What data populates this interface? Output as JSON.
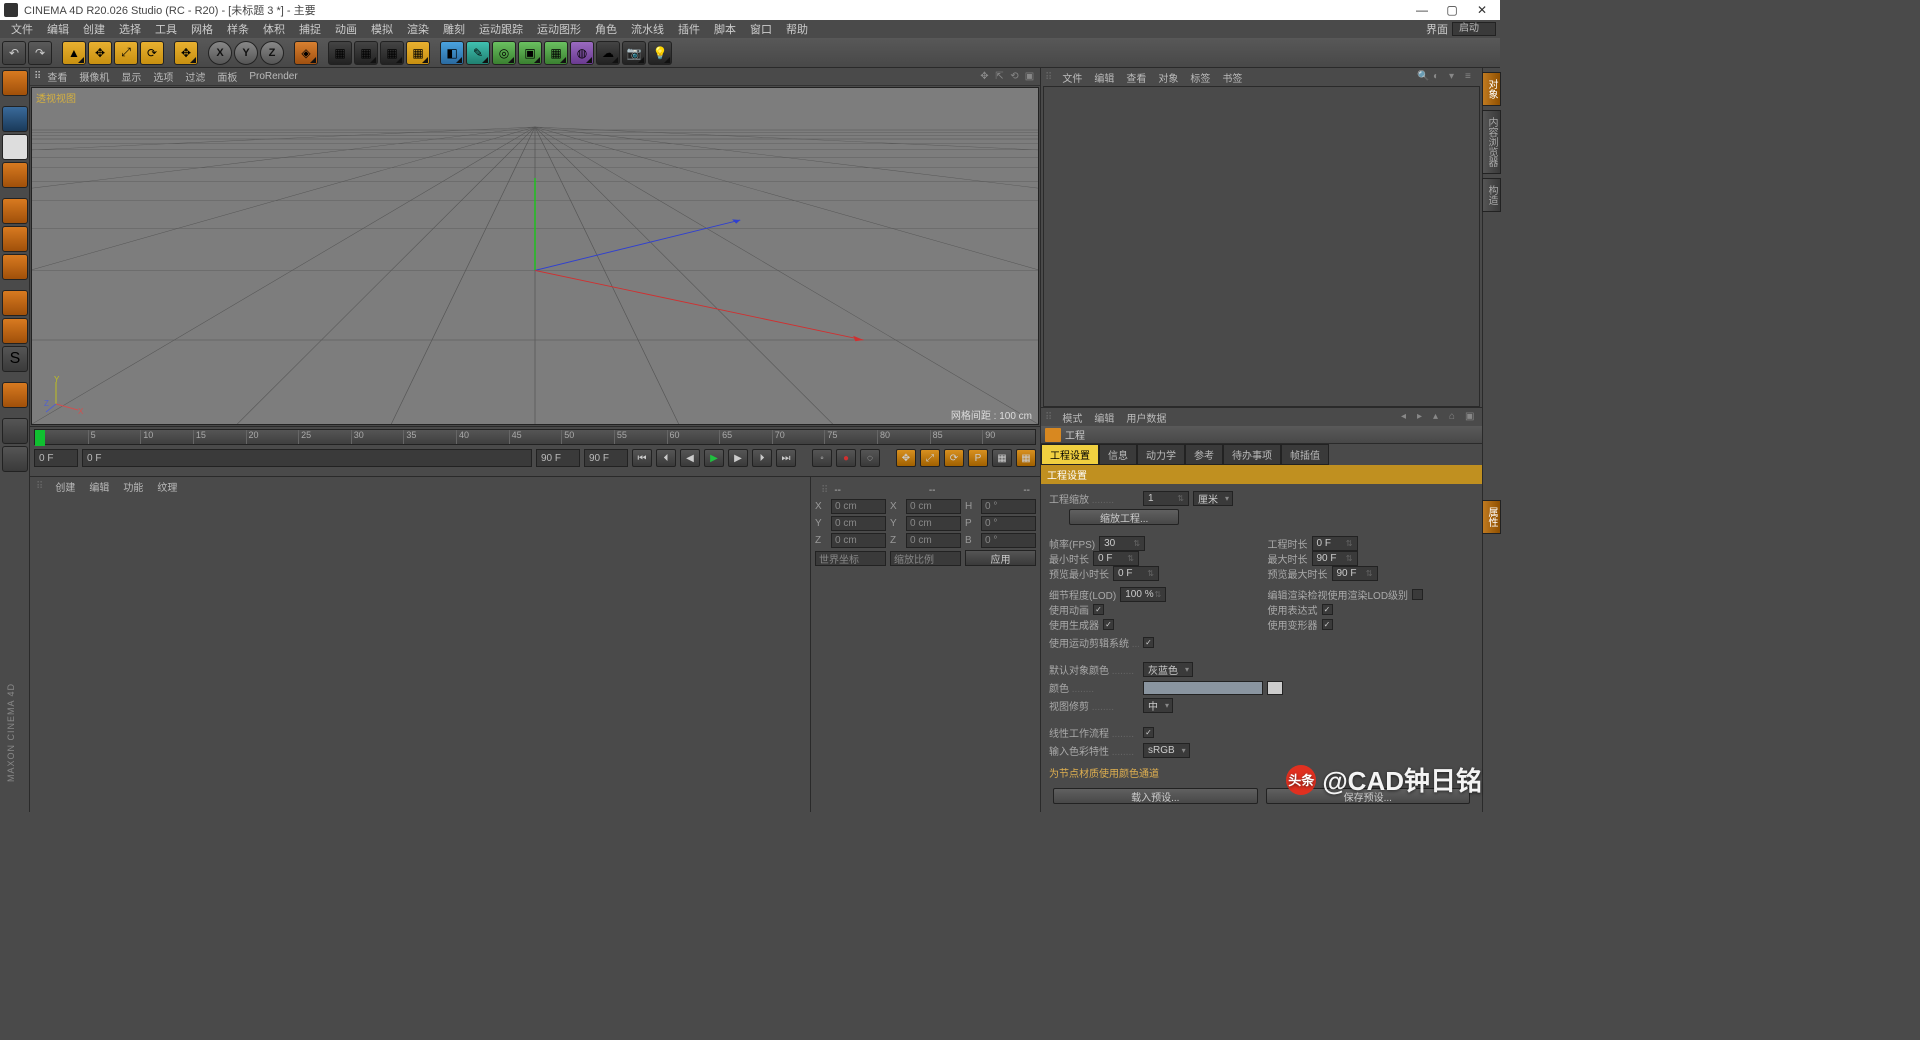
{
  "title": "CINEMA 4D R20.026 Studio (RC - R20) - [未标题 3 *] - 主要",
  "menubar": [
    "文件",
    "编辑",
    "创建",
    "选择",
    "工具",
    "网格",
    "样条",
    "体积",
    "捕捉",
    "动画",
    "模拟",
    "渲染",
    "雕刻",
    "运动跟踪",
    "运动图形",
    "角色",
    "流水线",
    "插件",
    "脚本",
    "窗口",
    "帮助"
  ],
  "menubar_right": {
    "label": "界面",
    "value": "启动"
  },
  "viewbar": [
    "查看",
    "摄像机",
    "显示",
    "选项",
    "过滤",
    "面板",
    "ProRender"
  ],
  "viewport": {
    "label": "透视视图",
    "footer": "网格间距 : 100 cm"
  },
  "axis_labels": {
    "x": "X",
    "y": "Y",
    "z": "Z"
  },
  "timeline": {
    "ticks": [
      "0",
      "5",
      "10",
      "15",
      "20",
      "25",
      "30",
      "35",
      "40",
      "45",
      "50",
      "55",
      "60",
      "65",
      "70",
      "75",
      "80",
      "85",
      "90"
    ],
    "start": "0 F",
    "current": "0 F",
    "slider_end": "90 F",
    "end": "90 F"
  },
  "bottom_tabs": [
    "创建",
    "编辑",
    "功能",
    "纹理"
  ],
  "coord": {
    "dash": "--",
    "X": "X",
    "Y": "Y",
    "Z": "Z",
    "H": "H",
    "P": "P",
    "B": "B",
    "zero_cm": "0 cm",
    "zero_deg": "0 °",
    "drop1": "世界坐标",
    "drop2": "缩放比例",
    "apply": "应用"
  },
  "obj_panel": {
    "menu": [
      "文件",
      "编辑",
      "查看",
      "对象",
      "标签",
      "书签"
    ]
  },
  "attr_panel": {
    "menu": [
      "模式",
      "编辑",
      "用户数据"
    ],
    "title": "工程",
    "tabs": [
      "工程设置",
      "信息",
      "动力学",
      "参考",
      "待办事项",
      "帧插值"
    ],
    "section": "工程设置",
    "scale_lbl": "工程缩放",
    "scale_val": "1",
    "scale_unit": "厘米",
    "scale_btn": "缩放工程...",
    "fps_lbl": "帧率(FPS)",
    "fps_val": "30",
    "projtime_lbl": "工程时长",
    "projtime_val": "0 F",
    "mintime_lbl": "最小时长",
    "mintime_val": "0 F",
    "maxtime_lbl": "最大时长",
    "maxtime_val": "90 F",
    "pvmin_lbl": "预览最小时长",
    "pvmin_val": "0 F",
    "pvmax_lbl": "预览最大时长",
    "pvmax_val": "90 F",
    "lod_lbl": "细节程度(LOD)",
    "lod_val": "100 %",
    "lod_chk_lbl": "编辑渲染检视使用渲染LOD级别",
    "anim_lbl": "使用动画",
    "gen_lbl": "使用生成器",
    "mot_lbl": "使用运动剪辑系统",
    "expr_lbl": "使用表达式",
    "def_lbl": "使用变形器",
    "defcolor_lbl": "默认对象颜色",
    "defcolor_val": "灰蓝色",
    "color_lbl": "颜色",
    "clip_lbl": "视图修剪",
    "clip_val": "中",
    "linear_lbl": "线性工作流程",
    "input_lbl": "输入色彩特性",
    "input_val": "sRGB",
    "note": "为节点材质使用颜色通道",
    "load_btn": "载入预设...",
    "save_btn": "保存预设..."
  },
  "rside_tabs": [
    "对象",
    "内容浏览器",
    "构造",
    "属性"
  ],
  "watermark": {
    "handle": "头条",
    "name": "@CAD钟日铭"
  },
  "maxon": "MAXON CINEMA 4D"
}
